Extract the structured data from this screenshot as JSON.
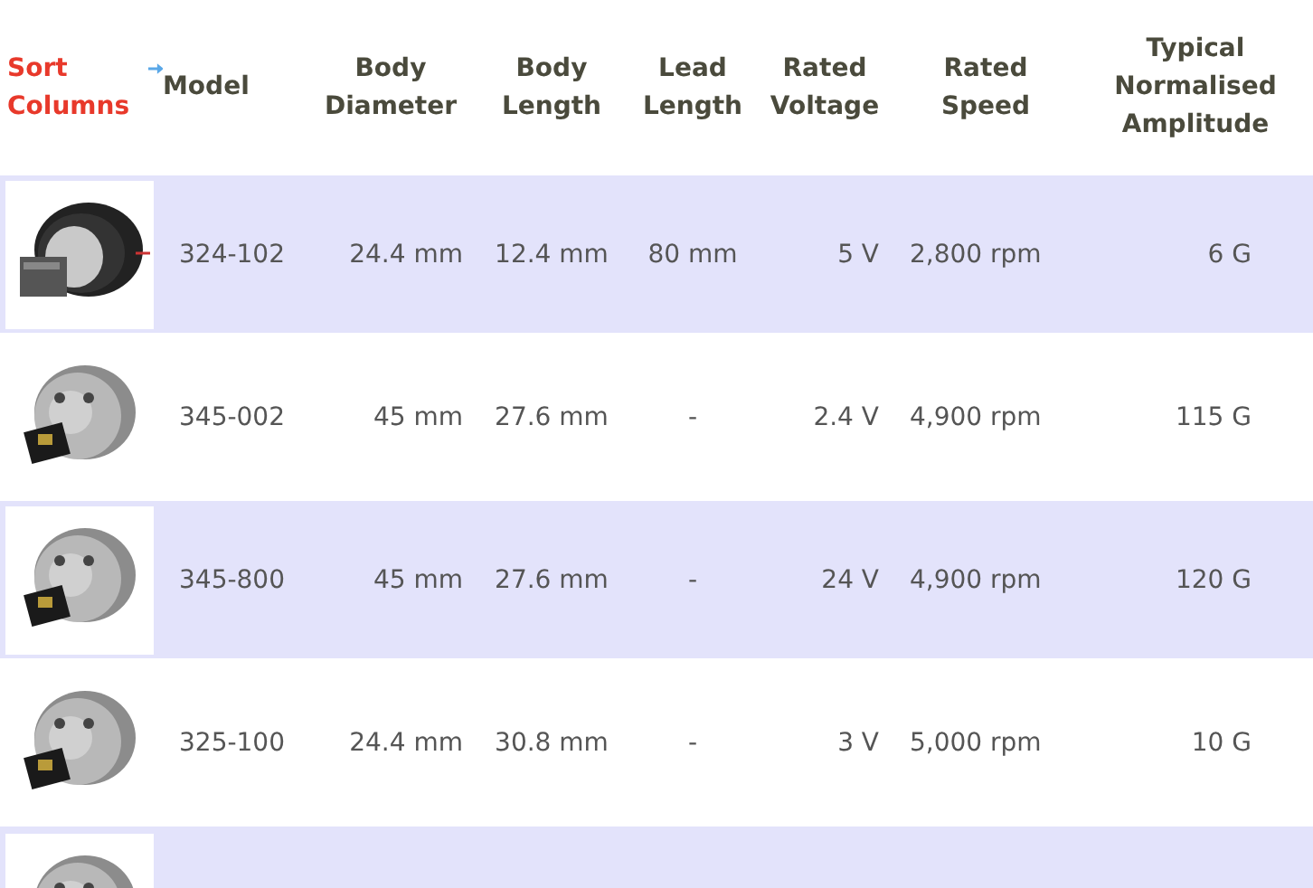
{
  "sort_link": "Sort\nColumns",
  "columns": [
    "Model",
    "Body\nDiameter",
    "Body\nLength",
    "Lead\nLength",
    "Rated\nVoltage",
    "Rated\nSpeed",
    "Typical\nNormalised\nAmplitude"
  ],
  "rows": [
    {
      "kind": "full",
      "cells": [
        "324-102",
        "24.4 mm",
        "12.4 mm",
        "80 mm",
        "5 V",
        "2,800 rpm",
        "6 G"
      ]
    },
    {
      "kind": "full",
      "cells": [
        "345-002",
        "45 mm",
        "27.6 mm",
        "-",
        "2.4 V",
        "4,900 rpm",
        "115 G"
      ]
    },
    {
      "kind": "full",
      "cells": [
        "345-800",
        "45 mm",
        "27.6 mm",
        "-",
        "24 V",
        "4,900 rpm",
        "120 G"
      ]
    },
    {
      "kind": "full",
      "cells": [
        "325-100",
        "24.4 mm",
        "30.8 mm",
        "-",
        "3 V",
        "5,000 rpm",
        "10 G"
      ]
    },
    {
      "kind": "image_only",
      "cells": []
    }
  ]
}
